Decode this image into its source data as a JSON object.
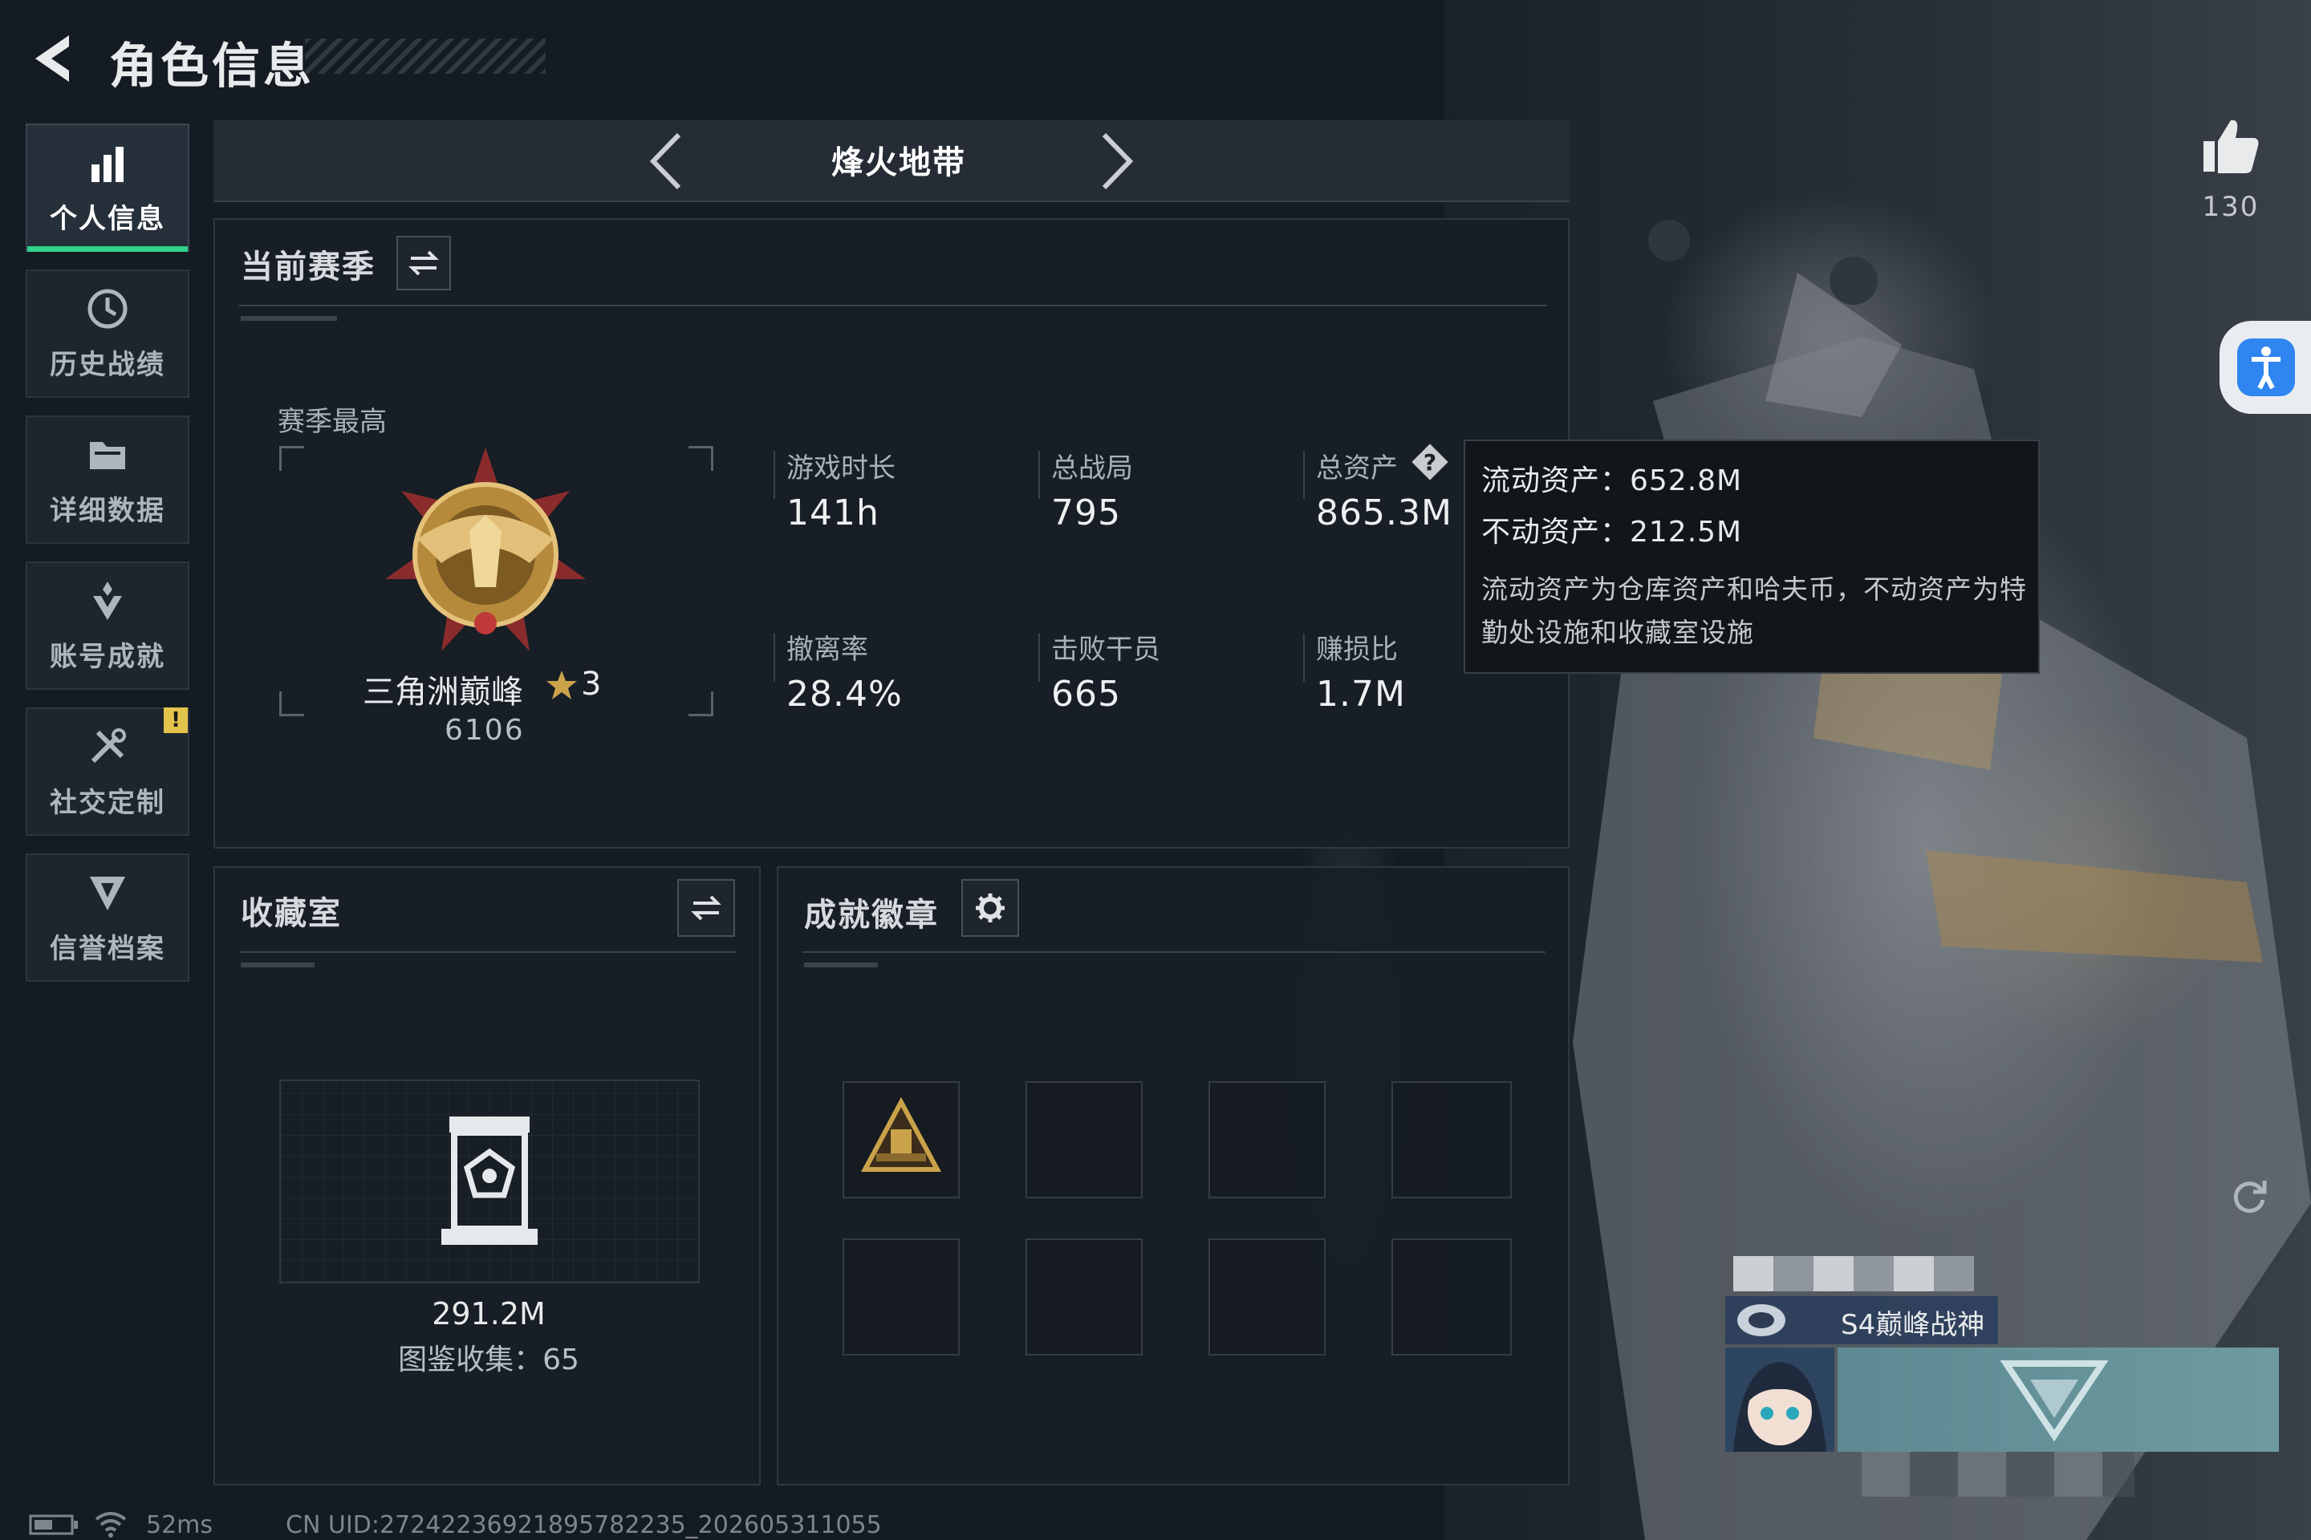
{
  "header": {
    "title": "角色信息",
    "back_icon": "back-arrow-icon"
  },
  "sidebar": {
    "items": [
      {
        "label": "个人信息",
        "icon": "bar-chart-icon",
        "active": true
      },
      {
        "label": "历史战绩",
        "icon": "history-clock-icon",
        "active": false
      },
      {
        "label": "详细数据",
        "icon": "folder-icon",
        "active": false
      },
      {
        "label": "账号成就",
        "icon": "achievement-icon",
        "active": false
      },
      {
        "label": "社交定制",
        "icon": "tools-icon",
        "active": false,
        "alert": "!"
      },
      {
        "label": "信誉档案",
        "icon": "credit-shield-icon",
        "active": false
      }
    ]
  },
  "mode_selector": {
    "name": "烽火地带"
  },
  "season": {
    "title": "当前赛季",
    "best_label": "赛季最高",
    "rank_name": "三角洲巅峰",
    "rank_stars": "3",
    "rank_points": "6106",
    "stats": [
      {
        "label": "游戏时长",
        "value": "141h"
      },
      {
        "label": "总战局",
        "value": "795"
      },
      {
        "label": "总资产",
        "value": "865.3M"
      },
      {
        "label": "撤离率",
        "value": "28.4%"
      },
      {
        "label": "击败干员",
        "value": "665"
      },
      {
        "label": "赚损比",
        "value": "1.7M"
      }
    ]
  },
  "asset_tooltip": {
    "liquid": "流动资产：652.8M",
    "fixed": "不动资产：212.5M",
    "note": "流动资产为仓库资产和哈夫币，不动资产为特勤处设施和收藏室设施"
  },
  "collection": {
    "title": "收藏室",
    "value": "291.2M",
    "catalog": "图鉴收集：65"
  },
  "badges": {
    "title": "成就徽章"
  },
  "right": {
    "likes": "130",
    "player_title": "S4巅峰战神"
  },
  "footer": {
    "ping": "52ms",
    "uid": "CN UID:27242236921895782235_202605311055"
  },
  "colors": {
    "accent_green": "#2fd28a",
    "alert_yellow": "#e3c44a",
    "accessibility_blue": "#2f86f0",
    "rank_gold": "#c9a24a"
  }
}
